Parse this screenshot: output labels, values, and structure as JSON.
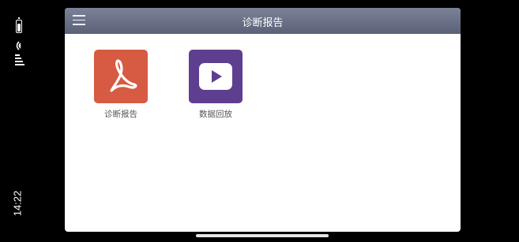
{
  "status": {
    "time": "14:22"
  },
  "header": {
    "title": "诊断报告"
  },
  "tiles": [
    {
      "label": "诊断报告",
      "icon": "pdf-icon",
      "color": "#d75a43"
    },
    {
      "label": "数据回放",
      "icon": "play-video-icon",
      "color": "#5e3f8f"
    }
  ],
  "colors": {
    "header_top": "#7c8398",
    "header_bottom": "#5b6276",
    "background": "#000000"
  }
}
